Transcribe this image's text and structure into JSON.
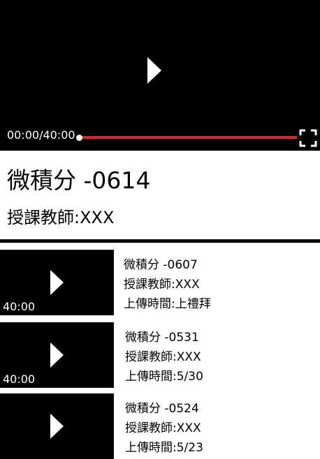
{
  "player": {
    "time": "00:00/40:00",
    "progress_fraction": 0.0,
    "accent_color": "#e3232c",
    "play_icon": "play-icon",
    "fullscreen_icon": "fullscreen-icon"
  },
  "current": {
    "title": "微積分 -0614",
    "teacher": "授課教師:XXX"
  },
  "list": [
    {
      "duration": "40:00",
      "title": "微積分 -0607",
      "teacher": "授課教師:XXX",
      "uploaded": "上傳時間:上禮拜"
    },
    {
      "duration": "40:00",
      "title": "微積分 -0531",
      "teacher": "授課教師:XXX",
      "uploaded": "上傳時間:5/30"
    },
    {
      "duration": "",
      "title": "微積分 -0524",
      "teacher": "授課教師:XXX",
      "uploaded": "上傳時間:5/23"
    }
  ]
}
